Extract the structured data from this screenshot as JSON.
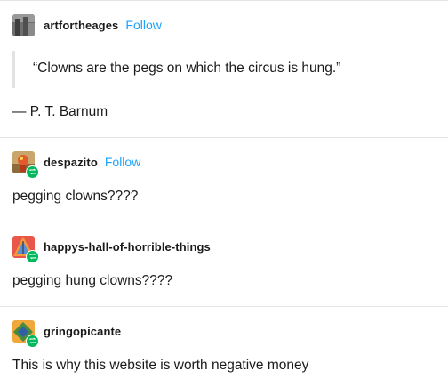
{
  "posts": [
    {
      "username": "artfortheages",
      "follow_label": "Follow",
      "quote": "“Clowns are the pegs on which the circus is hung.”",
      "attribution": "— P. T. Barnum"
    },
    {
      "username": "despazito",
      "follow_label": "Follow",
      "body": "pegging clowns????"
    },
    {
      "username": "happys-hall-of-horrible-things",
      "body": "pegging hung clowns????"
    },
    {
      "username": "gringopicante",
      "body": "This is why this website is worth negative money"
    }
  ],
  "colors": {
    "follow": "#1aa3ff",
    "reblog_badge": "#00b85c",
    "divider": "#e4e4e4"
  },
  "icons": {
    "reblog": "reblog-icon"
  }
}
